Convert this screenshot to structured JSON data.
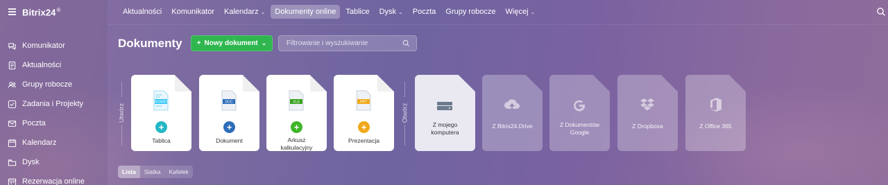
{
  "app": {
    "logo": "Bitrix24",
    "logo_mark": "®"
  },
  "sidebar": {
    "items": [
      {
        "label": "Komunikator",
        "icon": "chat-icon"
      },
      {
        "label": "Aktualności",
        "icon": "news-icon"
      },
      {
        "label": "Grupy robocze",
        "icon": "groups-icon"
      },
      {
        "label": "Zadania i Projekty",
        "icon": "tasks-icon"
      },
      {
        "label": "Poczta",
        "icon": "mail-icon"
      },
      {
        "label": "Kalendarz",
        "icon": "calendar-icon"
      },
      {
        "label": "Dysk",
        "icon": "disk-icon"
      },
      {
        "label": "Rezerwacja online",
        "icon": "booking-icon"
      }
    ]
  },
  "topnav": {
    "items": [
      {
        "label": "Aktualności",
        "chevron": ""
      },
      {
        "label": "Komunikator",
        "chevron": ""
      },
      {
        "label": "Kalendarz",
        "chevron": "⌄"
      },
      {
        "label": "Dokumenty online",
        "chevron": "",
        "active": true
      },
      {
        "label": "Tablice",
        "chevron": ""
      },
      {
        "label": "Dysk",
        "chevron": "⌄"
      },
      {
        "label": "Poczta",
        "chevron": ""
      },
      {
        "label": "Grupy robocze",
        "chevron": ""
      },
      {
        "label": "Więcej",
        "chevron": "⌄"
      }
    ]
  },
  "header": {
    "title": "Dokumenty",
    "new_button": "Nowy dokument",
    "new_button_plus": "+",
    "new_button_chevron": "⌄",
    "filter_placeholder": "Filtrowanie i wyszukiwanie"
  },
  "create": {
    "vertical_label": "Utwórz",
    "cards": [
      {
        "label": "Tablica",
        "tag": "BOARD",
        "tag_color": "#2fc6f6",
        "plus_color": "#23b7c4"
      },
      {
        "label": "Dokument",
        "tag": "DOC",
        "tag_color": "#2d6dba",
        "plus_color": "#2d6dba"
      },
      {
        "label": "Arkusz kalkulacyjny",
        "tag": "XLS",
        "tag_color": "#3aa321",
        "plus_color": "#3eb52a"
      },
      {
        "label": "Prezentacja",
        "tag": "PPT",
        "tag_color": "#f0a91a",
        "plus_color": "#f0a91a"
      }
    ]
  },
  "open": {
    "vertical_label": "Otwórz",
    "cards": [
      {
        "label": "Z mojego komputera",
        "icon": "drive-icon"
      },
      {
        "label": "Z Bitrix24.Drive",
        "icon": "cloud-upload-icon"
      },
      {
        "label": "Z Dokumentów Google",
        "icon": "google-icon"
      },
      {
        "label": "Z Dropboxa",
        "icon": "dropbox-icon"
      },
      {
        "label": "Z Office 365",
        "icon": "office-icon"
      }
    ]
  },
  "views": [
    {
      "label": "Lista",
      "active": true
    },
    {
      "label": "Siatka",
      "active": false
    },
    {
      "label": "Kafelek",
      "active": false
    }
  ]
}
